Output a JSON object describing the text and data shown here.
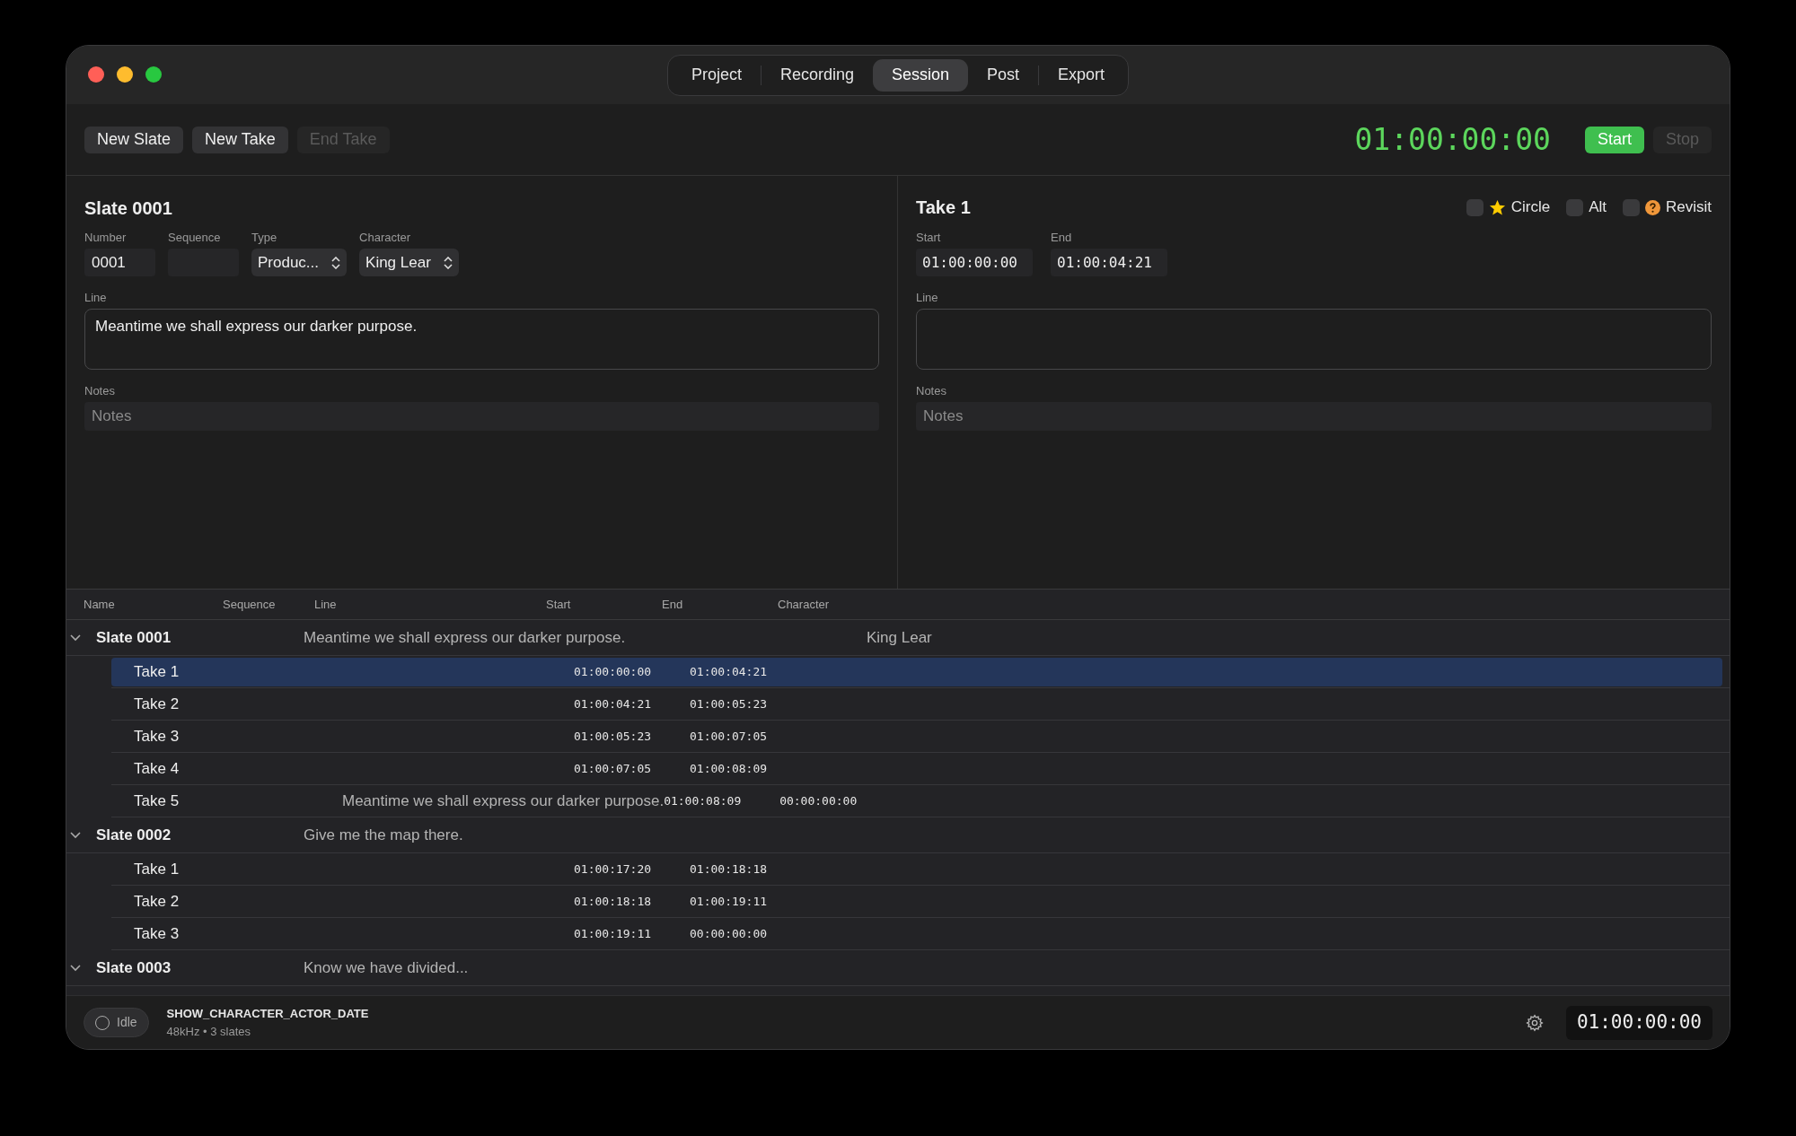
{
  "tabs": [
    {
      "label": "Project",
      "selected": false
    },
    {
      "label": "Recording",
      "selected": false
    },
    {
      "label": "Session",
      "selected": true
    },
    {
      "label": "Post",
      "selected": false
    },
    {
      "label": "Export",
      "selected": false
    }
  ],
  "toolbar": {
    "buttons": [
      {
        "label": "New Slate",
        "disabled": false
      },
      {
        "label": "New Take",
        "disabled": false
      },
      {
        "label": "End Take",
        "disabled": true
      }
    ],
    "timecode": "01:00:00:00",
    "transport": [
      {
        "label": "Start",
        "kind": "primary",
        "disabled": false
      },
      {
        "label": "Stop",
        "kind": "plain",
        "disabled": true
      }
    ]
  },
  "slate_panel": {
    "title": "Slate 0001",
    "fields": [
      {
        "label": "Number",
        "kind": "text",
        "value": "0001"
      },
      {
        "label": "Sequence",
        "kind": "text"
      },
      {
        "label": "Type",
        "kind": "select",
        "value": "Produc..."
      },
      {
        "label": "Character",
        "kind": "select",
        "value": "King Lear"
      }
    ],
    "line_label": "Line",
    "line": "Meantime we shall express our darker purpose.",
    "notes_label": "Notes",
    "notes_placeholder": "Notes"
  },
  "take_panel": {
    "title": "Take 1",
    "flags": [
      {
        "label": "Circle",
        "kind": "star",
        "checked": false
      },
      {
        "label": "Alt",
        "kind": "plain",
        "checked": false
      },
      {
        "label": "Revisit",
        "kind": "question",
        "checked": false
      }
    ],
    "fields": [
      {
        "label": "Start",
        "value": "01:00:00:00"
      },
      {
        "label": "End",
        "value": "01:00:04:21"
      }
    ],
    "line_label": "Line",
    "notes_label": "Notes",
    "notes_placeholder": "Notes"
  },
  "table": {
    "columns": [
      "Name",
      "Sequence",
      "Line",
      "Start",
      "End",
      "Character"
    ],
    "rows": [
      {
        "name": "Slate 0001",
        "line": "Meantime we shall express our darker purpose.",
        "character": "King Lear",
        "expanded": true,
        "children": [
          {
            "name": "Take 1",
            "start": "01:00:00:00",
            "end": "01:00:04:21",
            "selected": true
          },
          {
            "name": "Take 2",
            "start": "01:00:04:21",
            "end": "01:00:05:23",
            "selected": false
          },
          {
            "name": "Take 3",
            "start": "01:00:05:23",
            "end": "01:00:07:05",
            "selected": false
          },
          {
            "name": "Take 4",
            "start": "01:00:07:05",
            "end": "01:00:08:09",
            "selected": false
          },
          {
            "name": "Take 5",
            "line": "Meantime we shall express our darker purpose.",
            "start": "01:00:08:09",
            "end": "00:00:00:00",
            "selected": false
          }
        ]
      },
      {
        "name": "Slate 0002",
        "line": "Give me the map there.",
        "expanded": true,
        "children": [
          {
            "name": "Take 1",
            "start": "01:00:17:20",
            "end": "01:00:18:18",
            "selected": false
          },
          {
            "name": "Take 2",
            "start": "01:00:18:18",
            "end": "01:00:19:11",
            "selected": false
          },
          {
            "name": "Take 3",
            "start": "01:00:19:11",
            "end": "00:00:00:00",
            "selected": false
          }
        ]
      },
      {
        "name": "Slate 0003",
        "line": "Know we have divided...",
        "expanded": true,
        "children": []
      }
    ]
  },
  "status_bar": {
    "state": "Idle",
    "name": "SHOW_CHARACTER_ACTOR_DATE",
    "details": "48kHz • 3 slates",
    "timecode": "01:00:00:00"
  }
}
